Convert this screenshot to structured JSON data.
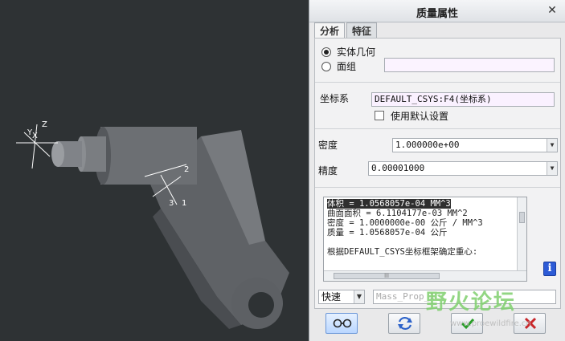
{
  "dialog": {
    "title": "质量属性",
    "close_glyph": "✕",
    "tabs": [
      {
        "label": "分析",
        "active": true
      },
      {
        "label": "特征",
        "active": false
      }
    ],
    "geometry_options": [
      {
        "label": "实体几何",
        "selected": true
      },
      {
        "label": "面组",
        "selected": false
      }
    ],
    "coord_sys": {
      "label": "坐标系",
      "value": "DEFAULT_CSYS:F4(坐标系)",
      "use_default_label": "使用默认设置"
    },
    "density": {
      "label": "密度",
      "value": "1.000000e+00"
    },
    "accuracy": {
      "label": "精度",
      "value": "0.00001000"
    },
    "results": {
      "lines": [
        "体积 =  1.0568057e-04  MM^3",
        "曲面面积 =  6.1104177e-03  MM^2",
        "密度 =  1.0000000e-00 公斤 / MM^3",
        "质量 =  1.0568057e-04 公斤",
        "",
        "根据DEFAULT_CSYS坐标框架确定重心:"
      ],
      "scroll_grip": "lll"
    },
    "mode": {
      "value": "快速"
    },
    "name_field": {
      "placeholder": "Mass_Prop_1"
    },
    "info_glyph": "i"
  },
  "viewport": {
    "axis_labels": [
      "Z",
      "Y",
      "X",
      "2",
      "3",
      "1"
    ]
  },
  "watermark": {
    "text": "野火论坛",
    "url": "www.proewildfire.cn"
  },
  "colors": {
    "viewport_bg": "#2e3234",
    "part_gray": "#6b6e72",
    "dialog_bg": "#e9e9ea",
    "ok_green": "#2a9d2a",
    "cancel_red": "#c8262a"
  }
}
